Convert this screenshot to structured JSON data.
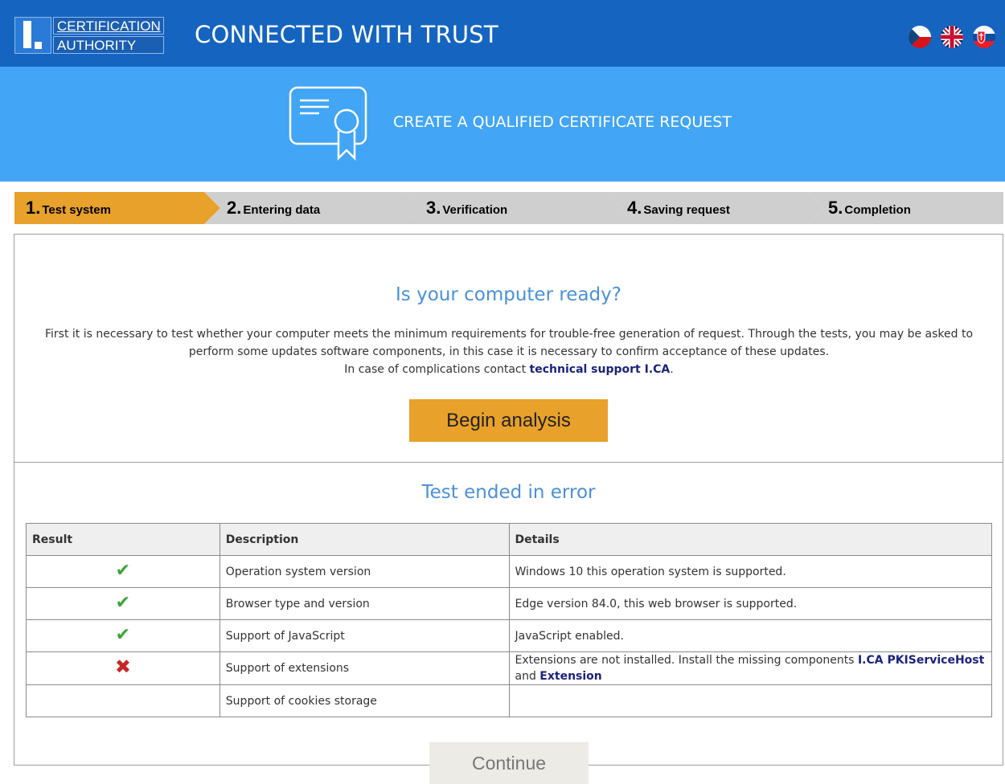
{
  "header": {
    "logo_line1": "CERTIFICATION",
    "logo_line2": "AUTHORITY",
    "tagline": "CONNECTED WITH TRUST",
    "languages": [
      "Czech",
      "English",
      "Slovak"
    ]
  },
  "banner": {
    "icon": "certificate-icon",
    "title": "CREATE A QUALIFIED CERTIFICATE REQUEST"
  },
  "steps": [
    {
      "num": "1.",
      "label": "Test system",
      "active": true
    },
    {
      "num": "2.",
      "label": "Entering data",
      "active": false
    },
    {
      "num": "3.",
      "label": "Verification",
      "active": false
    },
    {
      "num": "4.",
      "label": "Saving request",
      "active": false
    },
    {
      "num": "5.",
      "label": "Completion",
      "active": false
    }
  ],
  "ready": {
    "heading": "Is your computer ready?",
    "text_line1": "First it is necessary to test whether your computer meets the minimum requirements for trouble-free generation of request. Through the tests, you may be asked to perform some updates software components, in this case it is necessary to confirm acceptance of these updates.",
    "text_line2_prefix": "In case of complications contact",
    "support_link": "technical support I.CA",
    "text_line2_suffix": ".",
    "begin_button": "Begin analysis"
  },
  "results": {
    "heading": "Test ended in error",
    "columns": [
      "Result",
      "Description",
      "Details"
    ],
    "rows": [
      {
        "status": "ok",
        "description": "Operation system version",
        "details": "Windows 10 this operation system is supported."
      },
      {
        "status": "ok",
        "description": "Browser type and version",
        "details": "Edge version 84.0, this web browser is supported."
      },
      {
        "status": "ok",
        "description": "Support of JavaScript",
        "details": "JavaScript enabled."
      },
      {
        "status": "error",
        "description": "Support of extensions",
        "details_prefix": "Extensions are not installed. Install the missing components",
        "link1": "I.CA PKIServiceHost",
        "details_mid": "and",
        "link2": "Extension"
      },
      {
        "status": "",
        "description": "Support of cookies storage",
        "details": ""
      }
    ]
  },
  "continue_button": "Continue",
  "icons": {
    "ok": "✔",
    "error": "✖"
  },
  "colors": {
    "header": "#1565c0",
    "banner": "#42a5f5",
    "active_step": "#e8a12a",
    "inactive_step": "#cfcfcf",
    "heading": "#4a90d9",
    "link": "#1a237e"
  }
}
